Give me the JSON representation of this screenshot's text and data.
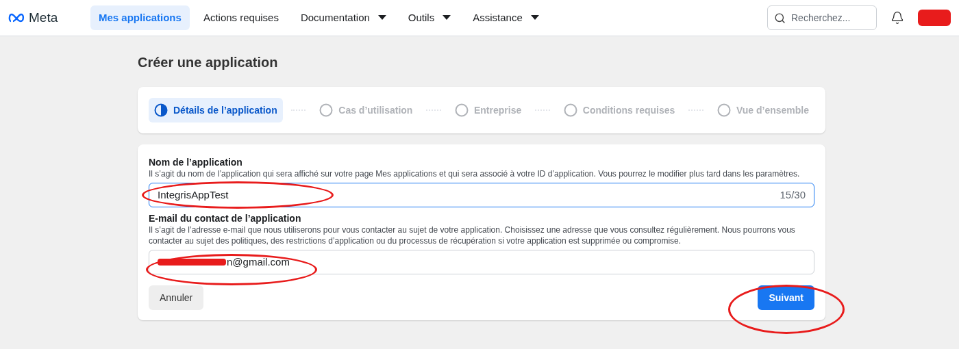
{
  "nav": {
    "logo": "Meta",
    "items": [
      {
        "label": "Mes applications",
        "selected": true,
        "dropdown": false
      },
      {
        "label": "Actions requises",
        "selected": false,
        "dropdown": false
      },
      {
        "label": "Documentation",
        "selected": false,
        "dropdown": true
      },
      {
        "label": "Outils",
        "selected": false,
        "dropdown": true
      },
      {
        "label": "Assistance",
        "selected": false,
        "dropdown": true
      }
    ],
    "search": {
      "placeholder": "Recherchez..."
    }
  },
  "page_title": "Créer une application",
  "steps": [
    {
      "label": "Détails de l’application",
      "selected": true
    },
    {
      "label": "Cas d’utilisation",
      "selected": false
    },
    {
      "label": "Entreprise",
      "selected": false
    },
    {
      "label": "Conditions requises",
      "selected": false
    },
    {
      "label": "Vue d’ensemble",
      "selected": false
    }
  ],
  "fields": [
    {
      "label": "Nom de l’application",
      "help": "Il s’agit du nom de l’application qui sera affiché sur votre page Mes applications et qui sera associé à votre ID d’application. Vous pourrez le modifier plus tard dans les paramètres.",
      "value": "IntegrisAppTest",
      "counter": "15/30",
      "focused": true,
      "redacted": false
    },
    {
      "label": "E-mail du contact de l’application",
      "help": "Il s’agit de l’adresse e-mail que nous utiliserons pour vous contacter au sujet de votre application. Choisissez une adresse que vous consultez régulièrement. Nous pourrons vous contacter au sujet des politiques, des restrictions d’application ou du processus de récupération si votre application est supprimée ou compromise.",
      "value": "n@gmail.com",
      "focused": false,
      "redacted": true
    }
  ],
  "buttons": [
    {
      "label": "Annuler",
      "kind": "secondary"
    },
    {
      "label": "Suivant",
      "kind": "primary"
    }
  ]
}
